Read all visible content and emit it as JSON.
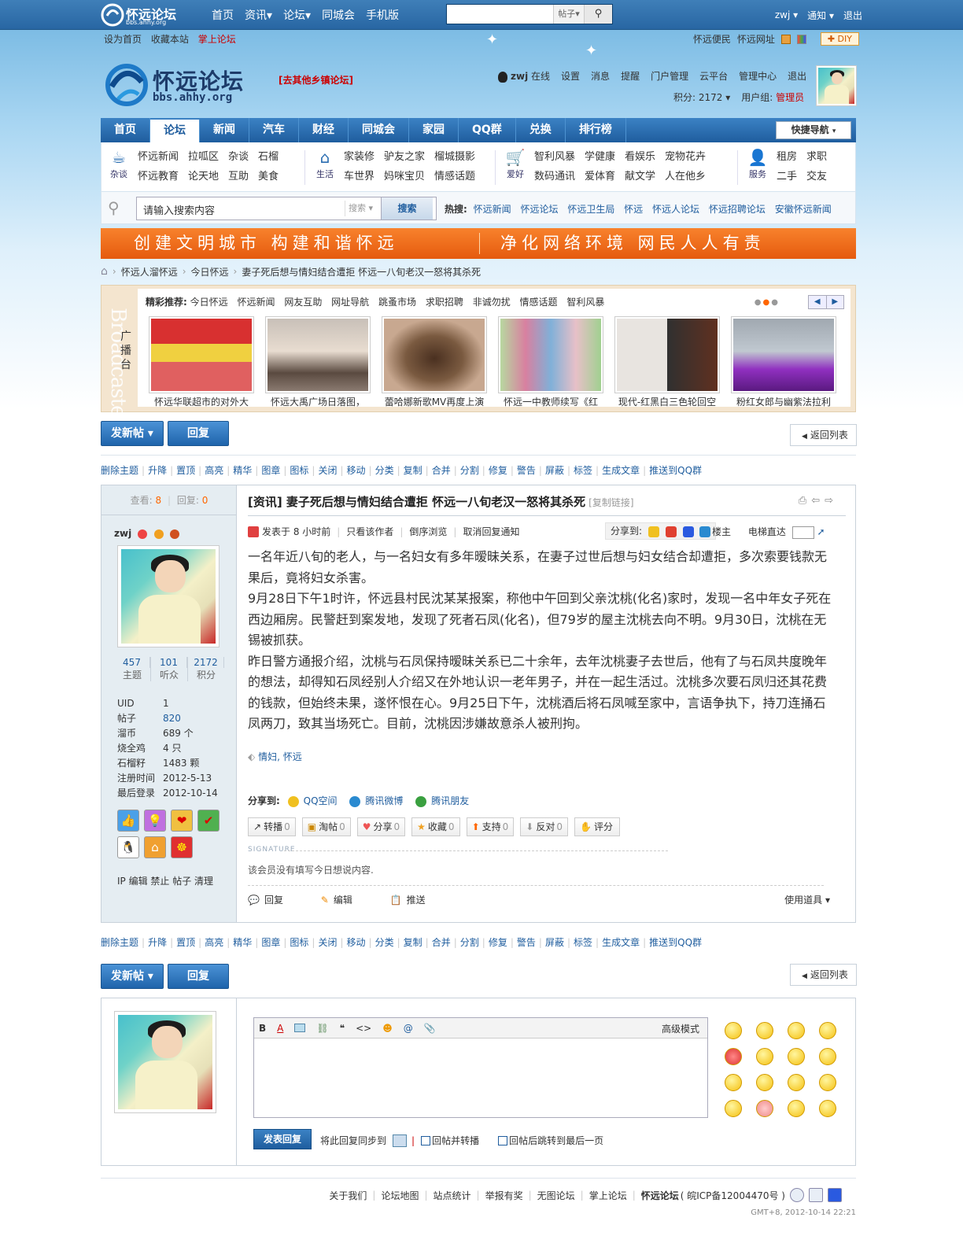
{
  "topbar": {
    "logo_text": "怀远论坛",
    "logo_sub": "bbs.ahhy.org",
    "nav": [
      "首页",
      "资讯▾",
      "论坛▾",
      "同城会",
      "手机版"
    ],
    "search_type": "帖子▾",
    "user": "zwj ▾",
    "notify": "通知 ▾",
    "logout": "退出"
  },
  "toolbar2": {
    "set_home": "设为首页",
    "favorite": "收藏本站",
    "mobile": "掌上论坛",
    "convenience": "怀远便民",
    "site_url": "怀远网址",
    "diy": "✚ DIY"
  },
  "header": {
    "logo_cn": "怀远论坛",
    "logo_url": "bbs.ahhy.org",
    "other_forum": "[去其他乡镇论坛]",
    "username": "zwj",
    "online": "在线",
    "links": [
      "设置",
      "消息",
      "提醒",
      "门户管理",
      "云平台",
      "管理中心",
      "退出"
    ],
    "points": "积分: 2172 ▾",
    "group_label": "用户组:",
    "group": "管理员"
  },
  "mainnav": {
    "items": [
      "首页",
      "论坛",
      "新闻",
      "汽车",
      "财经",
      "同城会",
      "家园",
      "QQ群",
      "兑换",
      "排行榜"
    ],
    "quick": "快捷导航"
  },
  "subnav": {
    "groups": [
      {
        "label": "杂谈",
        "rows": [
          [
            "怀远新闻",
            "拉呱区",
            "杂谈",
            "石榴"
          ],
          [
            "怀远教育",
            "论天地",
            "互助",
            "美食"
          ]
        ]
      },
      {
        "label": "生活",
        "rows": [
          [
            "家装修",
            "驴友之家",
            "榴城摄影"
          ],
          [
            "车世界",
            "妈咪宝贝",
            "情感话题"
          ]
        ]
      },
      {
        "label": "爱好",
        "rows": [
          [
            "智利风暴",
            "学健康",
            "看娱乐",
            "宠物花卉"
          ],
          [
            "数码通讯",
            "爱体育",
            "献文学",
            "人在他乡"
          ]
        ]
      },
      {
        "label": "服务",
        "rows": [
          [
            "租房",
            "求职"
          ],
          [
            "二手",
            "交友"
          ]
        ]
      }
    ]
  },
  "search": {
    "value": "请输入搜索内容",
    "type": "搜索 ▾",
    "button": "搜索",
    "hot_label": "热搜:",
    "hot": [
      "怀远新闻",
      "怀远论坛",
      "怀远卫生局",
      "怀远",
      "怀远人论坛",
      "怀远招聘论坛",
      "安徽怀远新闻"
    ]
  },
  "banner": {
    "left": "创建文明城市 构建和谐怀远",
    "right": "净化网络环境 网民人人有责"
  },
  "breadcrumb": [
    "怀远人溜怀远",
    "今日怀远",
    "妻子死后想与情妇结合遭拒 怀远一八旬老汉一怒将其杀死"
  ],
  "broadcaster": {
    "side_en": "Broadcaster",
    "side_cn": "广播台",
    "rec_label": "精彩推荐:",
    "rec": [
      "今日怀远",
      "怀远新闻",
      "网友互助",
      "网址导航",
      "跳蚤市场",
      "求职招聘",
      "非诚勿扰",
      "情感话题",
      "智利风暴"
    ],
    "thumbs": [
      {
        "caption": "怀远华联超市的对外大",
        "c1": "#d83030",
        "c2": "#f0d040"
      },
      {
        "caption": "怀远大禹广场日落图，",
        "c1": "#c8c0b8",
        "c2": "#5a4a40"
      },
      {
        "caption": "蕾哈娜新歌MV再度上演",
        "c1": "#c8a890",
        "c2": "#4a3020"
      },
      {
        "caption": "怀远一中教师续写《红",
        "c1": "#b8d8a0",
        "c2": "#d880a0"
      },
      {
        "caption": "现代-红黑白三色轮回空",
        "c1": "#e8e4e0",
        "c2": "#603020"
      },
      {
        "caption": "粉红女郎与幽紫法拉利",
        "c1": "#a0a8b0",
        "c2": "#9030c0"
      }
    ]
  },
  "actions": {
    "new_post": "发新帖 ▾",
    "reply": "回复",
    "back": "返回列表"
  },
  "modbar": [
    "删除主题",
    "升降",
    "置顶",
    "高亮",
    "精华",
    "图章",
    "图标",
    "关闭",
    "移动",
    "分类",
    "复制",
    "合并",
    "分割",
    "修复",
    "警告",
    "屏蔽",
    "标签",
    "生成文章",
    "推送到QQ群"
  ],
  "post": {
    "views_label": "查看:",
    "views": "8",
    "replies_label": "回复:",
    "replies": "0",
    "author": "zwj",
    "title": "[资讯] 妻子死后想与情妇结合遭拒 怀远一八旬老汉一怒将其杀死",
    "copy_link": "[复制链接]",
    "posted": "发表于 8 小时前",
    "only_author": "只看该作者",
    "reverse": "倒序浏览",
    "cancel_notify": "取消回复通知",
    "share_to": "分享到:",
    "floor": "楼主",
    "elevator": "电梯直达",
    "body": [
      "一名年近八旬的老人，与一名妇女有多年暧昧关系，在妻子过世后想与妇女结合却遭拒，多次索要钱款无果后，竟将妇女杀害。",
      "9月28日下午1时许，怀远县村民沈某某报案，称他中午回到父亲沈桃(化名)家时，发现一名中年女子死在西边厢房。民警赶到案发地，发现了死者石凤(化名)，但79岁的屋主沈桃去向不明。9月30日，沈桃在无锡被抓获。",
      "昨日警方通报介绍，沈桃与石凤保持暧昧关系已二十余年，去年沈桃妻子去世后，他有了与石凤共度晚年的想法，却得知石凤经别人介绍又在外地认识一老年男子，并在一起生活过。沈桃多次要石凤归还其花费的钱款，但始终未果，遂怀恨在心。9月25日下午，沈桃酒后将石凤喊至家中，言语争执下，持刀连捅石凤两刀，致其当场死亡。目前，沈桃因涉嫌故意杀人被刑拘。"
    ],
    "tags": "情妇, 怀远",
    "share2_label": "分享到:",
    "share2": [
      "QQ空间",
      "腾讯微博",
      "腾讯朋友"
    ],
    "buttons": [
      {
        "label": "转播",
        "n": "0"
      },
      {
        "label": "淘帖",
        "n": "0"
      },
      {
        "label": "分享",
        "n": "0"
      },
      {
        "label": "收藏",
        "n": "0"
      },
      {
        "label": "支持",
        "n": "0"
      },
      {
        "label": "反对",
        "n": "0"
      },
      {
        "label": "评分",
        "n": ""
      }
    ],
    "sig_label": "SIGNATURE",
    "sig_text": "该会员没有填写今日想说内容.",
    "foot": [
      "回复",
      "编辑",
      "推送"
    ],
    "use_tool": "使用道具 ▾"
  },
  "author_info": {
    "stats": [
      {
        "n": "457",
        "l": "主题"
      },
      {
        "n": "101",
        "l": "听众"
      },
      {
        "n": "2172",
        "l": "积分"
      }
    ],
    "fields": [
      {
        "k": "UID",
        "v": "1"
      },
      {
        "k": "帖子",
        "v": "820"
      },
      {
        "k": "溜币",
        "v": "689 个"
      },
      {
        "k": "烧全鸡",
        "v": "4 只"
      },
      {
        "k": "石榴籽",
        "v": "1483 颗"
      },
      {
        "k": "注册时间",
        "v": "2012-5-13"
      },
      {
        "k": "最后登录",
        "v": "2012-10-14"
      }
    ],
    "ip_line": "IP 编辑 禁止 帖子 清理"
  },
  "reply_box": {
    "advanced": "高级模式",
    "submit": "发表回复",
    "sync": "将此回复同步到",
    "opt1": "回帖并转播",
    "opt2": "回帖后跳转到最后一页"
  },
  "footer": {
    "links": [
      "关于我们",
      "论坛地图",
      "站点统计",
      "举报有奖",
      "无图论坛",
      "掌上论坛"
    ],
    "site": "怀远论坛",
    "icp": "( 皖ICP备12004470号 )",
    "time": "GMT+8, 2012-10-14 22:21"
  },
  "colors": {
    "accent": "#1f5d9e",
    "banner": "#f07020",
    "red": "#cc0000"
  }
}
